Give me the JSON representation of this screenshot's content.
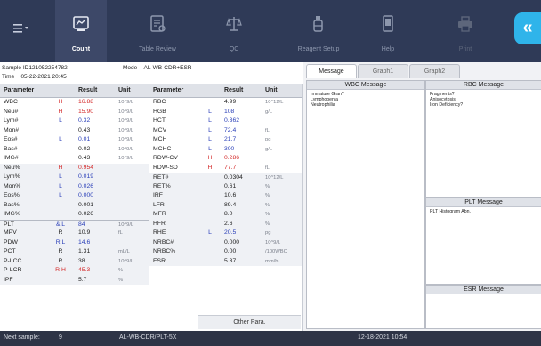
{
  "toolbar": {
    "items": [
      {
        "label": "Count",
        "icon": "count-icon",
        "active": true
      },
      {
        "label": "Table Review",
        "icon": "table-review-icon",
        "active": false
      },
      {
        "label": "QC",
        "icon": "qc-icon",
        "active": false
      },
      {
        "label": "Reagent Setup",
        "icon": "reagent-icon",
        "active": false
      },
      {
        "label": "Help",
        "icon": "help-icon",
        "active": false
      },
      {
        "label": "Print",
        "icon": "print-icon",
        "active": false
      }
    ],
    "menu_icon": "menu-icon",
    "expand_label": "«"
  },
  "sample": {
    "id_label": "Sample ID",
    "id": "121052254782",
    "mode_label": "Mode",
    "mode": "AL-WB-CDR+ESR",
    "time_label": "Time",
    "time": "05-22-2021 20:45"
  },
  "table_headers": {
    "parameter": "Parameter",
    "result": "Result",
    "unit": "Unit"
  },
  "left_table": [
    {
      "p": "WBC",
      "f": "H",
      "v": "16.88",
      "u": "10^9/L"
    },
    {
      "p": "Neu#",
      "f": "H",
      "v": "15.90",
      "u": "10^9/L"
    },
    {
      "p": "Lym#",
      "f": "L",
      "v": "0.32",
      "u": "10^9/L"
    },
    {
      "p": "Mon#",
      "f": "",
      "v": "0.43",
      "u": "10^9/L"
    },
    {
      "p": "Eos#",
      "f": "L",
      "v": "0.01",
      "u": "10^9/L"
    },
    {
      "p": "Bas#",
      "f": "",
      "v": "0.02",
      "u": "10^9/L"
    },
    {
      "p": "IMG#",
      "f": "",
      "v": "0.43",
      "u": "10^9/L"
    },
    {
      "p": "Neu%",
      "f": "H",
      "v": "0.954",
      "u": ""
    },
    {
      "p": "Lym%",
      "f": "L",
      "v": "0.019",
      "u": ""
    },
    {
      "p": "Mon%",
      "f": "L",
      "v": "0.026",
      "u": ""
    },
    {
      "p": "Eos%",
      "f": "L",
      "v": "0.000",
      "u": ""
    },
    {
      "p": "Bas%",
      "f": "",
      "v": "0.001",
      "u": ""
    },
    {
      "p": "IMG%",
      "f": "",
      "v": "0.026",
      "u": ""
    },
    {
      "p": "PLT",
      "f": "& L",
      "v": "84",
      "u": "10^9/L"
    },
    {
      "p": "MPV",
      "f": "R",
      "v": "10.9",
      "u": "fL"
    },
    {
      "p": "PDW",
      "f": "R L",
      "v": "14.6",
      "u": ""
    },
    {
      "p": "PCT",
      "f": "R",
      "v": "1.31",
      "u": "mL/L"
    },
    {
      "p": "P-LCC",
      "f": "R",
      "v": "38",
      "u": "10^9/L"
    },
    {
      "p": "P-LCR",
      "f": "R H",
      "v": "45.3",
      "u": "%"
    },
    {
      "p": "IPF",
      "f": "",
      "v": "5.7",
      "u": "%"
    }
  ],
  "right_table": [
    {
      "p": "RBC",
      "f": "",
      "v": "4.99",
      "u": "10^12/L"
    },
    {
      "p": "HGB",
      "f": "L",
      "v": "108",
      "u": "g/L"
    },
    {
      "p": "HCT",
      "f": "L",
      "v": "0.362",
      "u": ""
    },
    {
      "p": "MCV",
      "f": "L",
      "v": "72.4",
      "u": "fL"
    },
    {
      "p": "MCH",
      "f": "L",
      "v": "21.7",
      "u": "pg"
    },
    {
      "p": "MCHC",
      "f": "L",
      "v": "300",
      "u": "g/L"
    },
    {
      "p": "RDW-CV",
      "f": "H",
      "v": "0.286",
      "u": ""
    },
    {
      "p": "RDW-SD",
      "f": "H",
      "v": "77.7",
      "u": "fL"
    },
    {
      "p": "RET#",
      "f": "",
      "v": "0.0304",
      "u": "10^12/L"
    },
    {
      "p": "RET%",
      "f": "",
      "v": "0.61",
      "u": "%"
    },
    {
      "p": "IRF",
      "f": "",
      "v": "10.6",
      "u": "%"
    },
    {
      "p": "LFR",
      "f": "",
      "v": "89.4",
      "u": "%"
    },
    {
      "p": "MFR",
      "f": "",
      "v": "8.0",
      "u": "%"
    },
    {
      "p": "HFR",
      "f": "",
      "v": "2.6",
      "u": "%"
    },
    {
      "p": "RHE",
      "f": "L",
      "v": "20.5",
      "u": "pg"
    },
    {
      "p": "NRBC#",
      "f": "",
      "v": "0.000",
      "u": "10^9/L"
    },
    {
      "p": "NRBC%",
      "f": "",
      "v": "0.00",
      "u": "/100WBC"
    },
    {
      "p": "ESR",
      "f": "",
      "v": "5.37",
      "u": "mm/h"
    }
  ],
  "other_para_label": "Other Para.",
  "tabs": [
    "Message",
    "Graph1",
    "Graph2"
  ],
  "wbc_message": {
    "title": "WBC Message",
    "items": [
      "Immature Gran?",
      "Lymphopenia",
      "Neutrophilia"
    ]
  },
  "rbc_message": {
    "title": "RBC Message",
    "items": [
      "Fragments?",
      "Anisocytosis",
      "Iron Deficiency?"
    ]
  },
  "plt_message": {
    "title": "PLT Message",
    "items": [
      "PLT Histogram Abn."
    ]
  },
  "esr_message": {
    "title": "ESR Message",
    "items": []
  },
  "status": {
    "next_label": "Next sample:",
    "next_value": "9",
    "mode": "AL-WB-CDR/PLT-5X",
    "datetime": "12-18-2021 10:54"
  },
  "colors": {
    "toolbar": "#2f3a57",
    "high": "#d42a2a",
    "low": "#2a3fb8",
    "accent": "#2fb4ea"
  }
}
